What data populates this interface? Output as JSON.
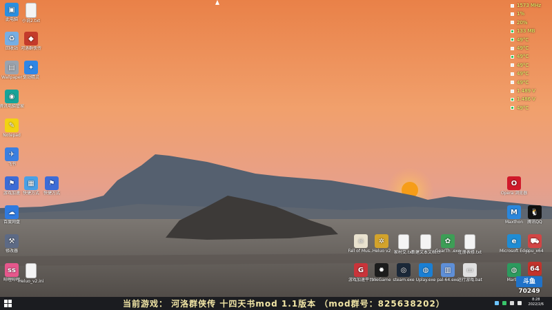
{
  "colors": {
    "sky_top": "#e37f45",
    "sky_mid": "#ef9a5e",
    "sky_low": "#d98a7d",
    "haze": "#b3a6ad",
    "mountain": "#4b5667",
    "ground": "#6e6a66",
    "sun": "#f6a21a",
    "taskbar": "#1b1c20",
    "banner": "#f2e6a6"
  },
  "desktop": {
    "icons": [
      {
        "name": "computer-icon",
        "label": "此电脑",
        "color": "#2b8fe0",
        "glyph": "▣"
      },
      {
        "name": "file-icon",
        "label": "小说2.txt",
        "color": "#ffffff",
        "glyph": ""
      },
      {
        "name": "recycle-bin-icon",
        "label": "回收站",
        "color": "#77aee3",
        "glyph": "♻"
      },
      {
        "name": "app-red-icon",
        "label": "河洛群侠传",
        "color": "#c43b2b",
        "glyph": "◆"
      },
      {
        "name": "disk-icon",
        "label": "Wallpaper",
        "color": "#9aa3ae",
        "glyph": "▤"
      },
      {
        "name": "blue-app-icon",
        "label": "驱动精灵",
        "color": "#2f86e6",
        "glyph": "✦"
      },
      {
        "name": "green-app-icon",
        "label": "腾讯电脑管家",
        "color": "#17a398",
        "glyph": "◉"
      },
      {
        "name": "notes-icon",
        "label": "Notepad",
        "color": "#f2d312",
        "glyph": "✎"
      },
      {
        "name": "bird-icon",
        "label": "飞书",
        "color": "#3b7fe0",
        "glyph": "✈"
      },
      {
        "name": "game-flag-icon",
        "label": "游戏加速",
        "color": "#3d6cd6",
        "glyph": "⚑"
      },
      {
        "name": "window-icon",
        "label": "快捷方式",
        "color": "#4aa0e6",
        "glyph": "▦"
      },
      {
        "name": "game-flag-icon-2",
        "label": "快捷方式",
        "color": "#3d6cd6",
        "glyph": "⚑"
      },
      {
        "name": "netdisk-icon",
        "label": "百度网盘",
        "color": "#2f7ae0",
        "glyph": "☁"
      },
      {
        "name": "tool-icon",
        "label": "修改器",
        "color": "#5d6a85",
        "glyph": "⚒"
      },
      {
        "name": "pink-app-icon",
        "label": "哔哩哔哩",
        "color": "#e6578c",
        "glyph": "ss"
      },
      {
        "name": "text-file-icon",
        "label": "Heluo_v2.ini",
        "color": "#ffffff",
        "glyph": ""
      }
    ],
    "bottom_icons": [
      {
        "name": "skull-icon",
        "label": "Fall of Mus...",
        "color": "#e9e2cf",
        "glyph": "☠"
      },
      {
        "name": "heluo-icon",
        "label": "Heluo v2",
        "color": "#d3a32b",
        "glyph": "✲"
      },
      {
        "name": "txt-file-icon",
        "label": "家村交.txt",
        "color": "#ffffff",
        "glyph": ""
      },
      {
        "name": "txt-file-icon-2",
        "label": "新建文本文档.txt",
        "color": "#ffffff",
        "glyph": ""
      },
      {
        "name": "gearth-icon",
        "label": "GearTh .exe",
        "color": "#3d9e56",
        "glyph": "✿"
      },
      {
        "name": "txt-file-icon-3",
        "label": "注册表修.txt",
        "color": "#ffffff",
        "glyph": ""
      },
      {
        "name": "red-shield-icon",
        "label": "游戏加速平台",
        "color": "#c9343a",
        "glyph": "G"
      },
      {
        "name": "wegame-icon",
        "label": "WeGame",
        "color": "#1c1c1c",
        "glyph": "✹"
      },
      {
        "name": "steam-icon",
        "label": "steam.exe",
        "color": "#1b2838",
        "glyph": "◎"
      },
      {
        "name": "uplay-icon",
        "label": "Uplay.exe",
        "color": "#1a7fd4",
        "glyph": "◍"
      },
      {
        "name": "pal-icon",
        "label": "pal-64.exe",
        "color": "#5e8fd8",
        "glyph": "▥"
      },
      {
        "name": "bat-icon",
        "label": "运行游戏.bat",
        "color": "#e0e0e0",
        "glyph": "▭"
      }
    ],
    "right_icons": [
      {
        "name": "opera-icon",
        "label": "Opera 浏览器",
        "color": "#d0192a",
        "glyph": "O"
      },
      {
        "name": "maxthon-icon",
        "label": "Maxthon",
        "color": "#2a87dd",
        "glyph": "M"
      },
      {
        "name": "qq-icon",
        "label": "腾讯QQ",
        "color": "#111111",
        "glyph": "🐧"
      },
      {
        "name": "edge-icon",
        "label": "Microsoft Edge",
        "color": "#1f8cd4",
        "glyph": "e"
      },
      {
        "name": "car-icon",
        "label": "cpu_x64",
        "color": "#d24545",
        "glyph": "⛟"
      },
      {
        "name": "world-icon",
        "label": "Marble",
        "color": "#2c9a5e",
        "glyph": "◍"
      },
      {
        "name": "cpu64-icon",
        "label": "64",
        "color": "#c2332c",
        "glyph": "64"
      }
    ]
  },
  "monitor": {
    "rows": [
      {
        "text": "1573 MHz",
        "color": "#eaff6a",
        "swatch": "#eeeeee"
      },
      {
        "text": "1%",
        "color": "#eaff6a",
        "swatch": "#eeeeee"
      },
      {
        "text": "20%",
        "color": "#eaff6a",
        "swatch": "#eeeeee"
      },
      {
        "text": "133 MB",
        "color": "#eaff6a",
        "swatch": "#35c75a"
      },
      {
        "text": "49°C",
        "color": "#eaff6a",
        "swatch": "#35c75a"
      },
      {
        "text": "49°C",
        "color": "#eaff6a",
        "swatch": "#eeeeee"
      },
      {
        "text": "49°C",
        "color": "#eaff6a",
        "swatch": "#35c75a"
      },
      {
        "text": "49°C",
        "color": "#eaff6a",
        "swatch": "#eeeeee"
      },
      {
        "text": "49°C",
        "color": "#eaff6a",
        "swatch": "#eeeeee"
      },
      {
        "text": "49°C",
        "color": "#eaff6a",
        "swatch": "#eeeeee"
      },
      {
        "text": "1.489 V",
        "color": "#eaff6a",
        "swatch": "#eeeeee"
      },
      {
        "text": "1.486 V",
        "color": "#eaff6a",
        "swatch": "#35c75a"
      },
      {
        "text": "49°C",
        "color": "#eaff6a",
        "swatch": "#35c75a"
      }
    ]
  },
  "taskbar": {
    "banner": "当前游戏： 河洛群侠传 十四天书mod 1.1版本 （mod群号：825638202）",
    "time": "8:28",
    "date": "2022/2/6"
  },
  "badge": {
    "logo": "斗鱼",
    "room_label": "房间号",
    "room_number": "70249"
  }
}
